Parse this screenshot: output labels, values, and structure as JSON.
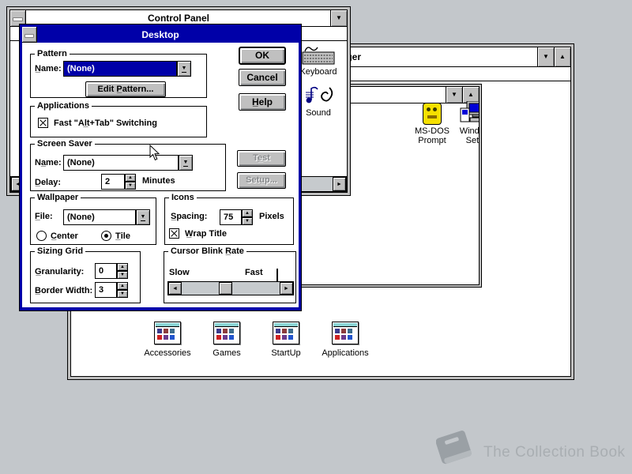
{
  "colors": {
    "titlebar_active": "#0000a8",
    "desktop_bg": "#c3c7cb",
    "selection": "#0000a8"
  },
  "glyphs": {
    "minimize": "▼",
    "maximize": "▲",
    "combo_arrow": "▼",
    "spin_up": "▲",
    "spin_down": "▼",
    "scroll_left": "◄",
    "scroll_right": "►"
  },
  "control_panel": {
    "title": "Control Panel",
    "icons": [
      {
        "label": "Keyboard"
      },
      {
        "label": "Sound"
      }
    ]
  },
  "program_manager": {
    "title": "Program Manager",
    "main_group": {
      "icons": [
        {
          "line1": "MS-DOS",
          "line2": "Prompt"
        },
        {
          "line1": "Windows",
          "line2": "Setup"
        }
      ]
    },
    "group_icons": [
      {
        "label": "Accessories"
      },
      {
        "label": "Games"
      },
      {
        "label": "StartUp"
      },
      {
        "label": "Applications"
      }
    ]
  },
  "dialog": {
    "title": "Desktop",
    "buttons": {
      "ok": "OK",
      "cancel": "Cancel",
      "help": "H̲elp"
    },
    "pattern": {
      "legend": "Pattern",
      "name_label": "N̲ame:",
      "name_value": "(None)",
      "edit_button": "Edit P̲attern..."
    },
    "applications": {
      "legend": "Applications",
      "fast_switch_label": "Fast \"Al̲t+Tab\" Switching"
    },
    "screen_saver": {
      "legend": "Screen Saver",
      "name_label": "Na̲me:",
      "name_value": "(None)",
      "delay_label": "D̲elay:",
      "delay_value": "2",
      "delay_unit": "Minutes",
      "test_button": "Te̲st",
      "setup_button": "Setu̲p..."
    },
    "wallpaper": {
      "legend": "Wallpaper",
      "file_label": "F̲ile:",
      "file_value": "(None)",
      "center_label": "C̲enter",
      "tile_label": "T̲ile"
    },
    "icons": {
      "legend": "Icons",
      "spacing_label": "S̲pacing:",
      "spacing_value": "75",
      "spacing_unit": "Pixels",
      "wrap_label": "W̲rap Title"
    },
    "sizing_grid": {
      "legend": "Sizing Grid",
      "granularity_label": "G̲ranularity:",
      "granularity_value": "0",
      "border_label": "B̲order Width:",
      "border_value": "3"
    },
    "cursor_blink": {
      "legend": "Cursor Blink R̲ate",
      "slow_label": "Slow",
      "fast_label": "Fast"
    }
  },
  "watermark": {
    "text": "The Collection Book"
  }
}
